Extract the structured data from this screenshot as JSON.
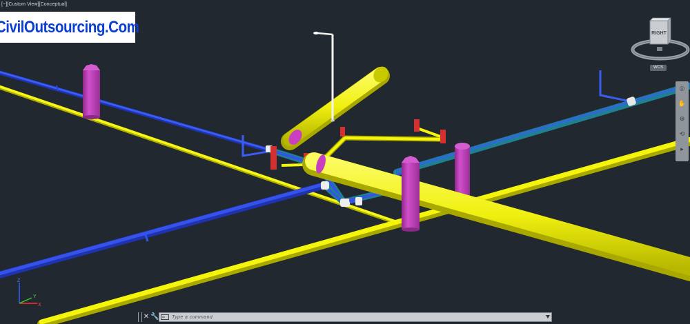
{
  "viewport": {
    "controls": {
      "menu_label": "[−]",
      "view_label": "[Custom View]",
      "style_label": "[Conceptual]"
    }
  },
  "watermark": {
    "text": "CivilOutsourcing.Com",
    "color": "#0b3fd0"
  },
  "viewcube": {
    "face_label": "RIGHT",
    "coordinate_system": "WCS"
  },
  "navigation_bar": {
    "tools": [
      "steering-wheel-icon",
      "pan-icon",
      "zoom-icon",
      "orbit-icon",
      "showmotion-icon"
    ]
  },
  "ucs": {
    "x_label": "X",
    "y_label": "Y",
    "z_label": "Z",
    "x_color": "#ff3030",
    "y_color": "#30d030",
    "z_color": "#3060ff"
  },
  "command_line": {
    "placeholder": "Type a command",
    "value": ""
  },
  "colors": {
    "background": "#212830",
    "water_pipe": "#f4f40a",
    "storm_pipe": "#2f49e0",
    "manhole": "#c93fbf",
    "valve": "#e03a3a",
    "fitting": "#f2f2f2",
    "light_pole": "#f0f0f0"
  }
}
